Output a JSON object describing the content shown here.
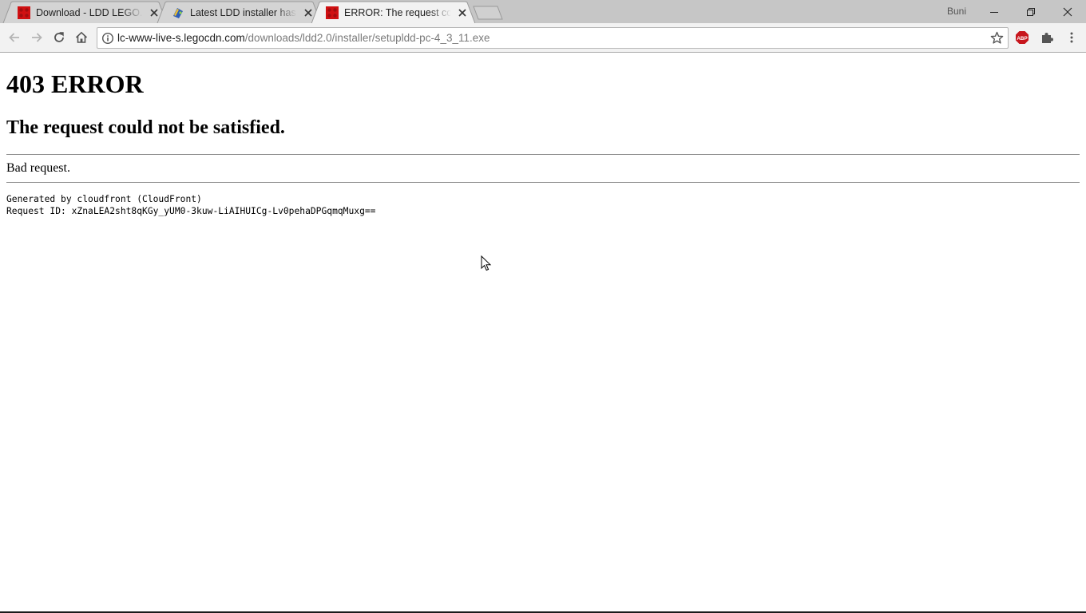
{
  "browser": {
    "tabs": [
      {
        "title": "Download - LDD LEGO.com",
        "favicon": "lego-brick-icon"
      },
      {
        "title": "Latest LDD installer has been removed",
        "favicon": "forum-icon"
      },
      {
        "title": "ERROR: The request could not be satisfied",
        "favicon": "lego-brick-icon"
      }
    ],
    "active_tab": 2,
    "profile_name": "Buni",
    "address": {
      "host": "lc-www-live-s.legocdn.com",
      "path": "/downloads/ldd2.0/installer/setupldd-pc-4_3_11.exe"
    },
    "extensions": [
      "adblock-plus-icon",
      "puzzle-extension-icon"
    ],
    "colors": {
      "tabstrip": "#c6c6c6",
      "toolbar": "#f2f2f2",
      "lego_red": "#d01012",
      "abp_red": "#c7161d"
    }
  },
  "page": {
    "heading": "403 ERROR",
    "subheading": "The request could not be satisfied.",
    "message": "Bad request.",
    "generated_by": "Generated by cloudfront (CloudFront)",
    "request_id": "Request ID: xZnaLEA2sht8qKGy_yUM0-3kuw-LiAIHUICg-Lv0pehaDPGqmqMuxg=="
  }
}
